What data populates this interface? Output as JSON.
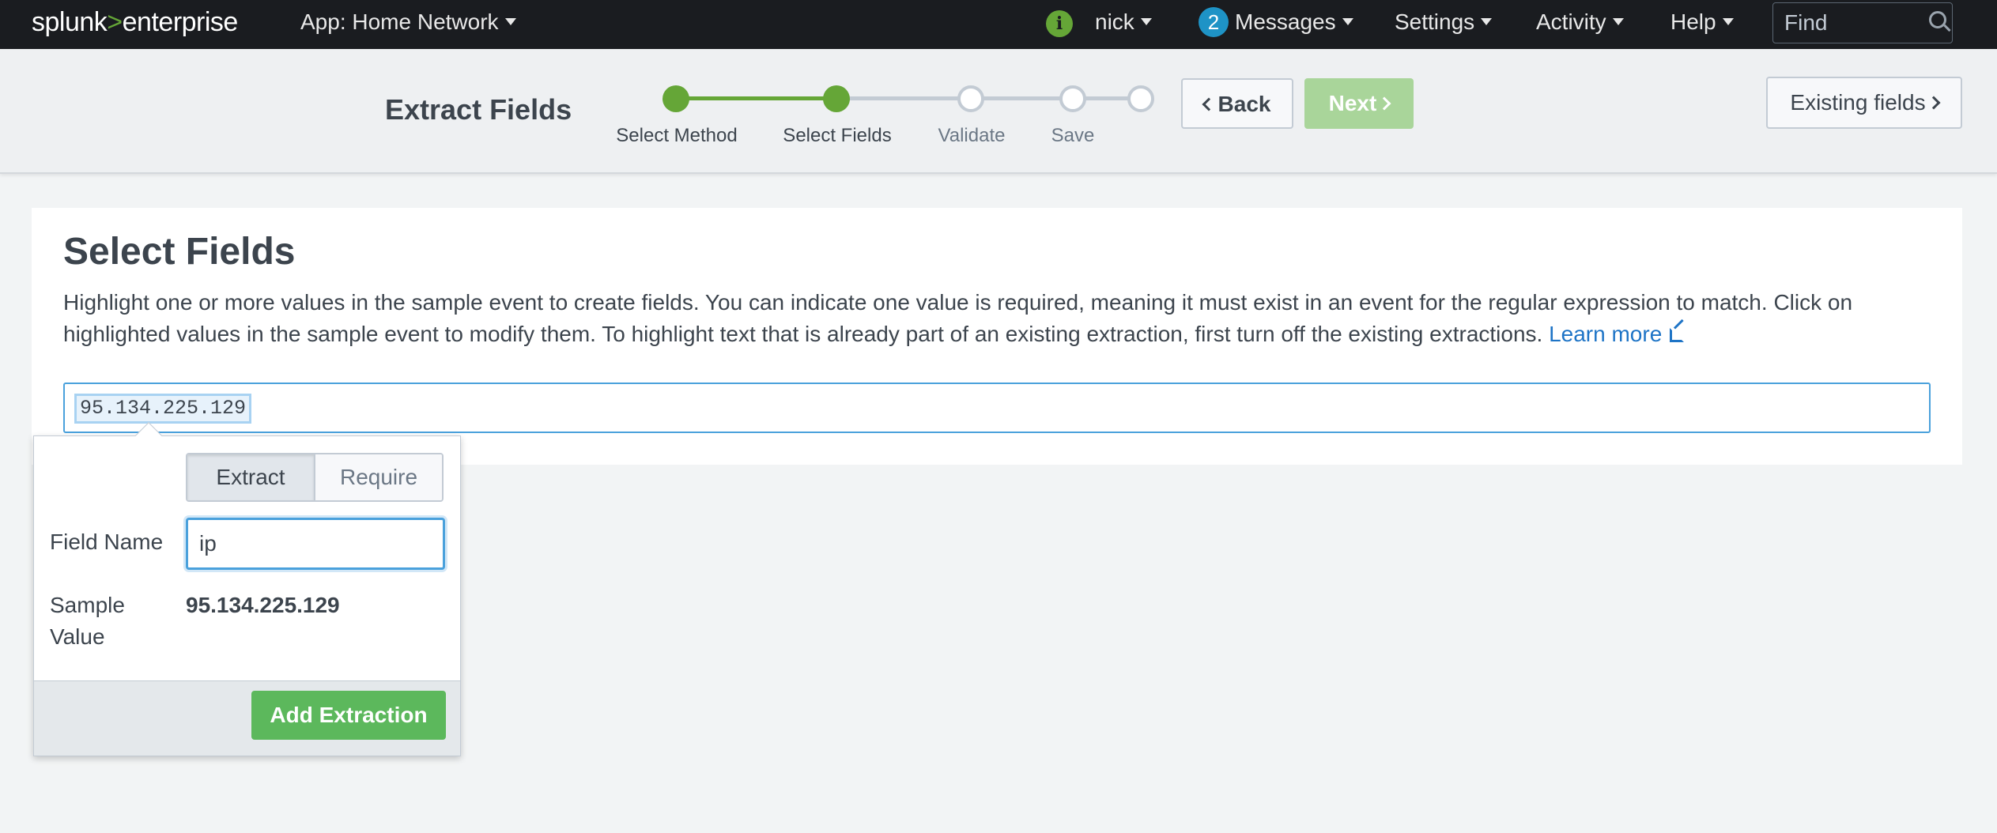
{
  "topbar": {
    "logo_splunk": "splunk",
    "logo_gt": ">",
    "logo_enterprise": "enterprise",
    "app_label": "App: Home Network",
    "info_icon_glyph": "i",
    "user": "nick",
    "messages_count": "2",
    "messages_label": "Messages",
    "settings_label": "Settings",
    "activity_label": "Activity",
    "help_label": "Help",
    "find_placeholder": "Find"
  },
  "wizard": {
    "title": "Extract Fields",
    "steps": [
      {
        "label": "Select Method",
        "state": "done"
      },
      {
        "label": "Select Fields",
        "state": "current"
      },
      {
        "label": "Validate",
        "state": "todo"
      },
      {
        "label": "Save",
        "state": "todo"
      }
    ],
    "back_label": "Back",
    "next_label": "Next",
    "existing_label": "Existing fields"
  },
  "main": {
    "title": "Select Fields",
    "description": "Highlight one or more values in the sample event to create fields. You can indicate one value is required, meaning it must exist in an event for the regular expression to match. Click on highlighted values in the sample event to modify them. To highlight text that is already part of an existing extraction, first turn off the existing extractions.",
    "learn_more": "Learn more",
    "sample_event": "95.134.225.129"
  },
  "popup": {
    "extract_label": "Extract",
    "require_label": "Require",
    "field_name_label": "Field Name",
    "field_name_value": "ip",
    "sample_label_1": "Sample",
    "sample_label_2": "Value",
    "sample_value": "95.134.225.129",
    "add_button": "Add Extraction"
  },
  "colors": {
    "accent_green": "#65a637",
    "link_blue": "#1e74c6",
    "badge_blue": "#1e93c6",
    "topbar_bg": "#1a1c20"
  }
}
